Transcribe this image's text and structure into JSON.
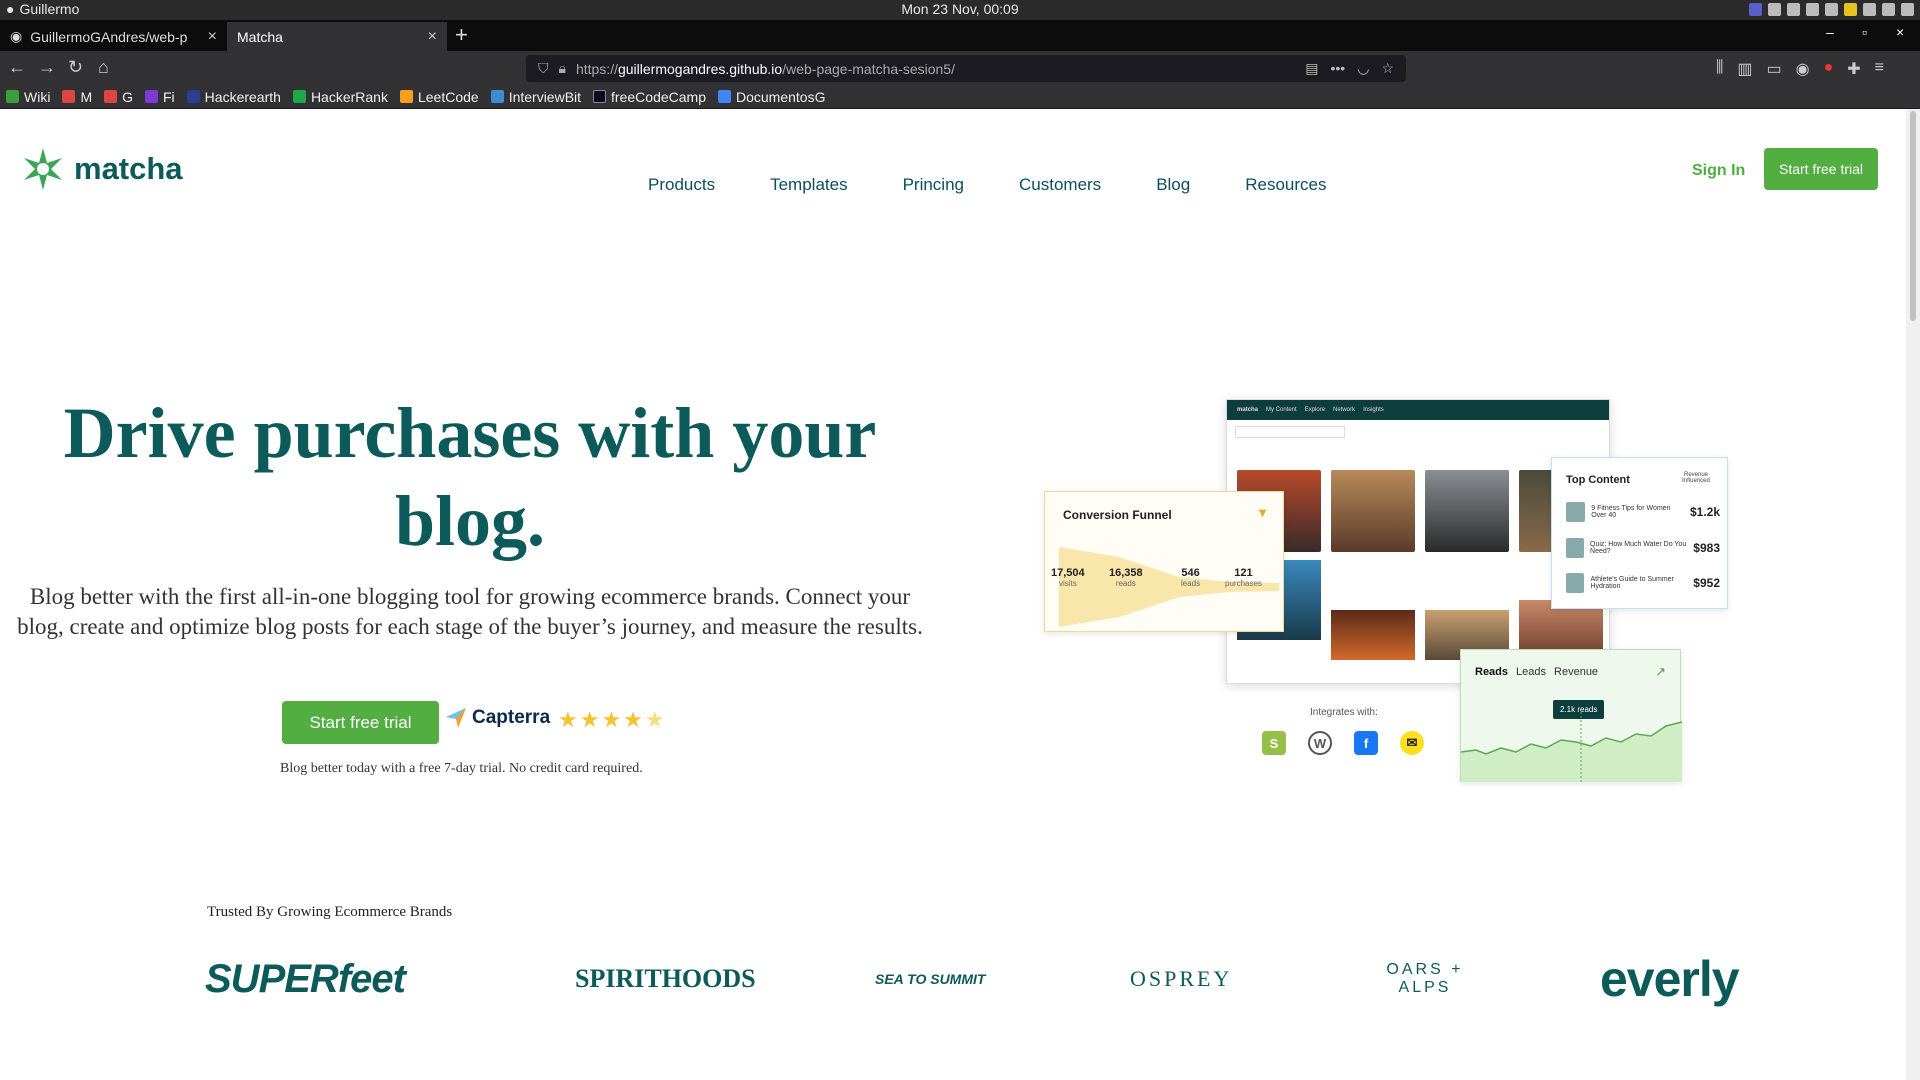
{
  "os": {
    "user": "Guillermo",
    "clock": "Mon 23 Nov, 00:09"
  },
  "browser": {
    "tabs": [
      {
        "label": "GuillermoGAndres/web-p",
        "active": false
      },
      {
        "label": "Matcha",
        "active": true
      }
    ],
    "url": {
      "scheme": "https://",
      "host": "guillermogandres.github.io",
      "path": "/web-page-matcha-sesion5/"
    },
    "bookmarks": [
      {
        "label": "Wiki",
        "color": "#3c9e3c"
      },
      {
        "label": "M",
        "color": "#d44"
      },
      {
        "label": "G",
        "color": "#d44"
      },
      {
        "label": "Fi",
        "color": "#7b3bd4"
      },
      {
        "label": "Hackerearth",
        "color": "#2c3e8f"
      },
      {
        "label": "HackerRank",
        "color": "#1ba94c"
      },
      {
        "label": "LeetCode",
        "color": "#f89f1b"
      },
      {
        "label": "InterviewBit",
        "color": "#3c8dd4"
      },
      {
        "label": "freeCodeCamp",
        "color": "#0a0a23"
      },
      {
        "label": "DocumentosG",
        "color": "#4285f4"
      }
    ]
  },
  "site": {
    "logo_text": "matcha",
    "nav": [
      "Products",
      "Templates",
      "Princing",
      "Customers",
      "Blog",
      "Resources"
    ],
    "sign_in": "Sign In",
    "cta_top": "Start free trial",
    "headline": "Drive purchases with your blog.",
    "subtext": "Blog better with the first all-in-one blogging tool for growing ecommerce brands. Connect your blog, create and optimize blog posts for each stage of the buyer’s journey, and measure the results.",
    "cta_main": "Start free trial",
    "capterra": "Capterra",
    "rating": 4.5,
    "trial_note": "Blog better today with a free 7-day trial. No credit card required."
  },
  "mockup": {
    "app_tabs": [
      "matcha",
      "My Content",
      "Explore",
      "Network",
      "Insights"
    ],
    "funnel": {
      "title": "Conversion Funnel",
      "stages": [
        {
          "value": "17,504",
          "label": "visits"
        },
        {
          "value": "16,358",
          "label": "reads"
        },
        {
          "value": "546",
          "label": "leads"
        },
        {
          "value": "121",
          "label": "purchases"
        }
      ]
    },
    "top_content": {
      "title": "Top Content",
      "col": "Revenue Influenced",
      "items": [
        {
          "text": "9 Fitness Tips for Women Over 40",
          "value": "$1.2k"
        },
        {
          "text": "Quiz: How Much Water Do You Need?",
          "value": "$983"
        },
        {
          "text": "Athlete's Guide to Summer Hydration",
          "value": "$952"
        }
      ]
    },
    "reads": {
      "tabs": [
        "Reads",
        "Leads",
        "Revenue"
      ],
      "tooltip": "2.1k reads"
    },
    "integrates": "Integrates with:"
  },
  "trusted": {
    "title": "Trusted By Growing Ecommerce Brands",
    "brands": [
      "SUPERfeet",
      "SPIRITHOODS",
      "SEA TO SUMMIT",
      "OSPREY",
      "OARS + ALPS",
      "everly"
    ]
  }
}
